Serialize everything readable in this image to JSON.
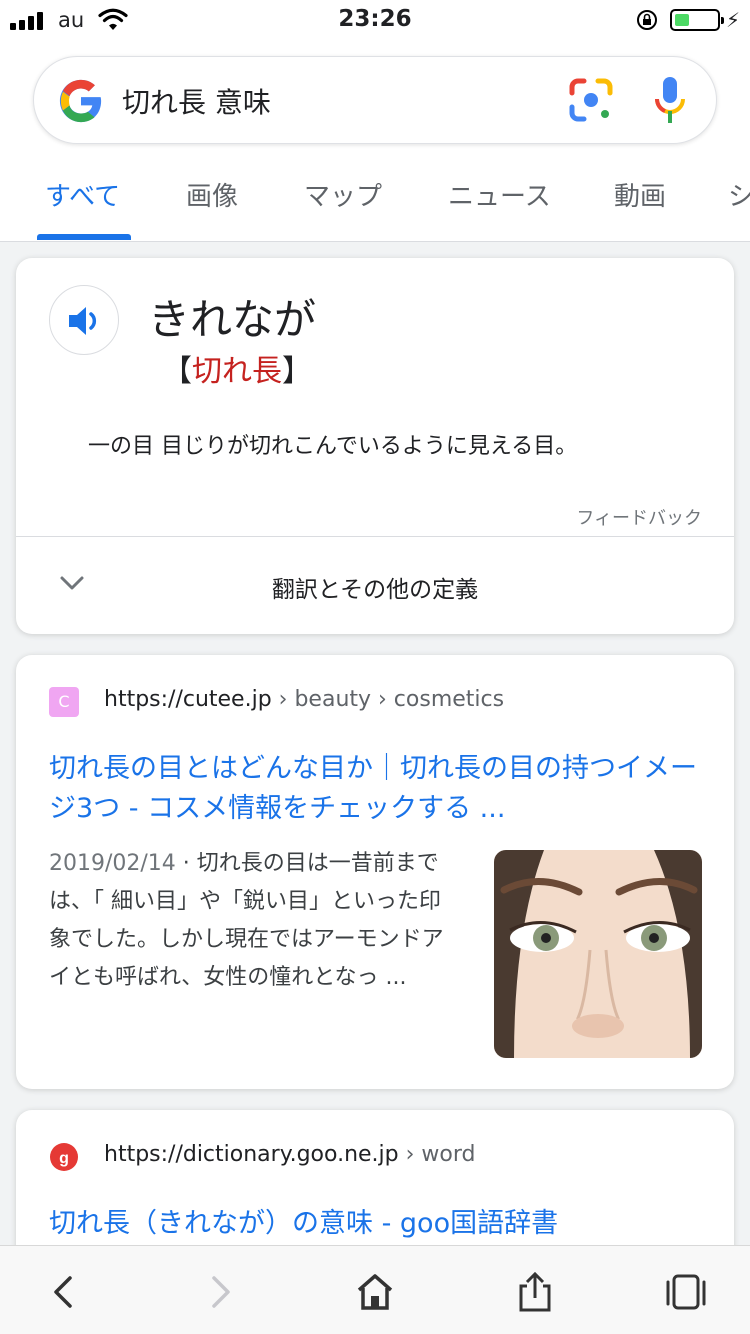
{
  "status_bar": {
    "carrier": "au",
    "time": "23:26",
    "battery_level": 0.35,
    "battery_color": "#4cd964"
  },
  "search": {
    "query": "切れ長 意味",
    "logo_icon": "google-g-icon",
    "lens_icon": "google-lens-icon",
    "mic_icon": "microphone-icon"
  },
  "tabs": [
    {
      "label": "すべて",
      "active": true
    },
    {
      "label": "画像",
      "active": false
    },
    {
      "label": "マップ",
      "active": false
    },
    {
      "label": "ニュース",
      "active": false
    },
    {
      "label": "動画",
      "active": false
    },
    {
      "label": "シ",
      "active": false
    }
  ],
  "dictionary": {
    "reading": "きれなが",
    "bracket_open": "【",
    "word": "切れ長",
    "bracket_close": "】",
    "definition": "一の目 目じりが切れこんでいるように見える目。",
    "feedback": "フィードバック",
    "more_label": "翻訳とその他の定義",
    "speaker_icon": "speaker-icon",
    "accent_color": "#c5221f"
  },
  "results": [
    {
      "favicon_letter": "C",
      "domain": "https://cutee.jp",
      "path": " › beauty › cosmetics",
      "title": "切れ長の目とはどんな目か｜切れ長の目の持つイメージ3つ - コスメ情報をチェックする ...",
      "date": "2019/02/14",
      "snippet": " · 切れ長の目は一昔前までは、「 細い目」や「鋭い目」といった印象でした。しかし現在ではアーモンドアイとも呼ばれ、女性の憧れとなっ ..."
    },
    {
      "domain": "https://dictionary.goo.ne.jp",
      "path": " › word",
      "title": "切れ長（きれなが）の意味 - goo国語辞書"
    }
  ],
  "toolbar": {
    "back_icon": "back-chevron-icon",
    "forward_icon": "forward-chevron-icon",
    "home_icon": "home-icon",
    "share_icon": "share-icon",
    "tabs_icon": "tabs-icon"
  },
  "colors": {
    "link": "#1a73e8",
    "tab_active": "#1a73e8"
  }
}
